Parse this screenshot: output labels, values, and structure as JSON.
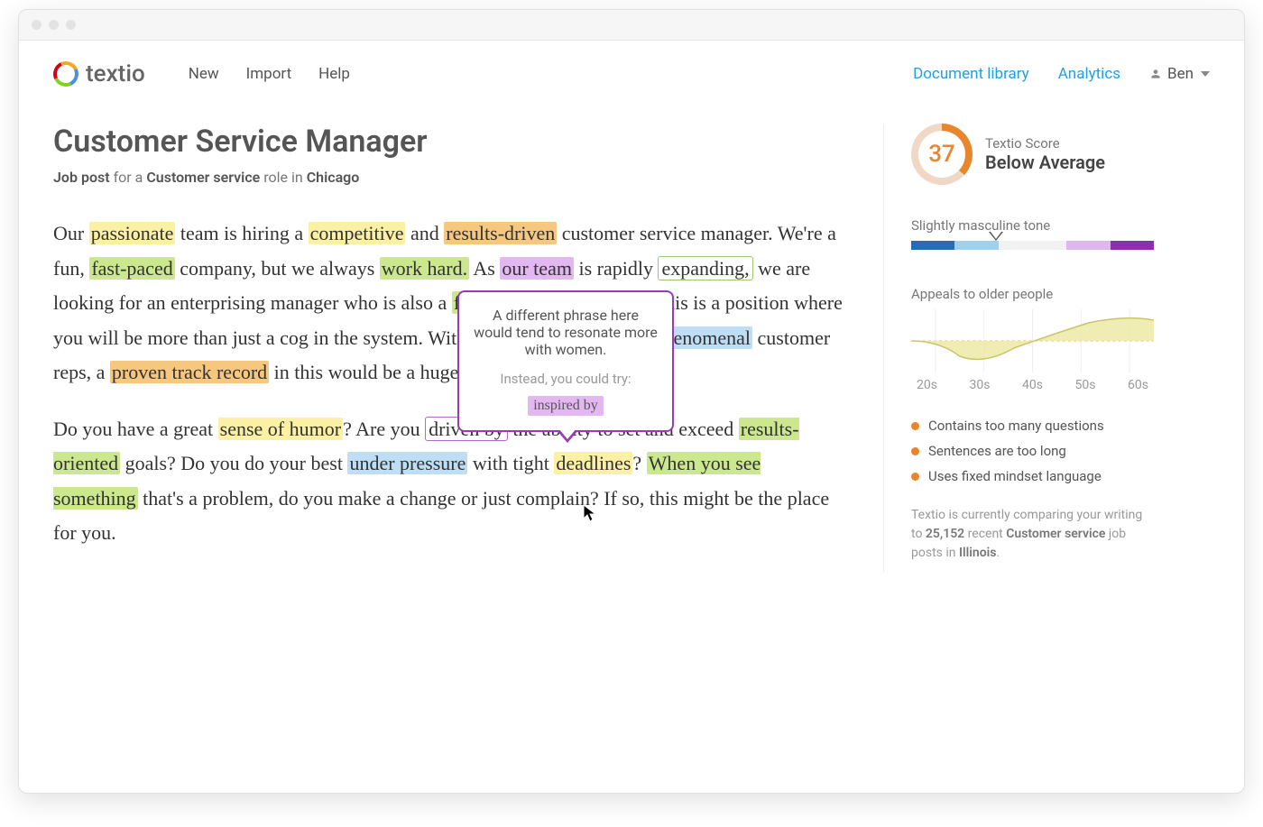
{
  "app": {
    "name": "textio"
  },
  "nav": {
    "new": "New",
    "import": "Import",
    "help": "Help"
  },
  "header_right": {
    "library": "Document library",
    "analytics": "Analytics",
    "user": "Ben"
  },
  "doc": {
    "title": "Customer Service Manager",
    "subtitle_prefix": "Job post",
    "subtitle_for": " for a ",
    "subtitle_role": "Customer service",
    "subtitle_mid": " role in ",
    "subtitle_loc": "Chicago",
    "p1": {
      "t1": "Our ",
      "w_passionate": "passionate",
      "t2": " team is hiring a ",
      "w_competitive": "competitive",
      "t3": " and ",
      "w_results_driven": "results-driven",
      "t4": " customer service manager. We're a fun, ",
      "w_fast_paced": "fast-paced",
      "t5": " company, but we always ",
      "w_work_hard": "work hard.",
      "t6": " As ",
      "w_our_team": "our team",
      "t7": " is rapidly ",
      "w_expanding": "expanding,",
      "t8": " we are looking for an enterprising manager who is also a ",
      "w_forward": "forward-thinking",
      "t9": " leader. This is a position where you will be more than just a cog in the system. With a big focus on leading ",
      "w_phenomenal": "phenomenal",
      "t10": " customer reps, a ",
      "w_proven": "proven track record",
      "t11": " in this would be a huge plus."
    },
    "p2": {
      "t1": "Do you have a great ",
      "w_sense": "sense of humor",
      "t2": "? Are you ",
      "w_driven": "driven by",
      "t3": " the ability to set and exceed ",
      "w_results_oriented": "results-oriented",
      "t4": " goals? Do you do your best ",
      "w_pressure": "under pressure",
      "t5": " with tight ",
      "w_deadlines": "deadlines",
      "t6": "? ",
      "w_when": "When you see something",
      "t7": " that's a problem, do you make a change or just complain? If so, this might be the place for you."
    }
  },
  "tip": {
    "msg": "A different phrase here would tend to resonate more with women.",
    "try": "Instead, you could try:",
    "suggestion": "inspired by"
  },
  "sidebar": {
    "score": "37",
    "score_label": "Textio Score",
    "score_desc": "Below Average",
    "tone_label": "Slightly masculine tone",
    "age_label": "Appeals to older people",
    "age_ticks": {
      "a": "20s",
      "b": "30s",
      "c": "40s",
      "d": "50s",
      "e": "60s"
    },
    "bullets": {
      "b1": "Contains too many questions",
      "b2": "Sentences are too long",
      "b3": "Uses fixed mindset language"
    },
    "footer": {
      "t1": "Textio is currently comparing your writing to ",
      "count": "25,152",
      "t2": " recent ",
      "role": "Customer service",
      "t3": " job posts in ",
      "loc": "Illinois",
      "t4": "."
    }
  }
}
